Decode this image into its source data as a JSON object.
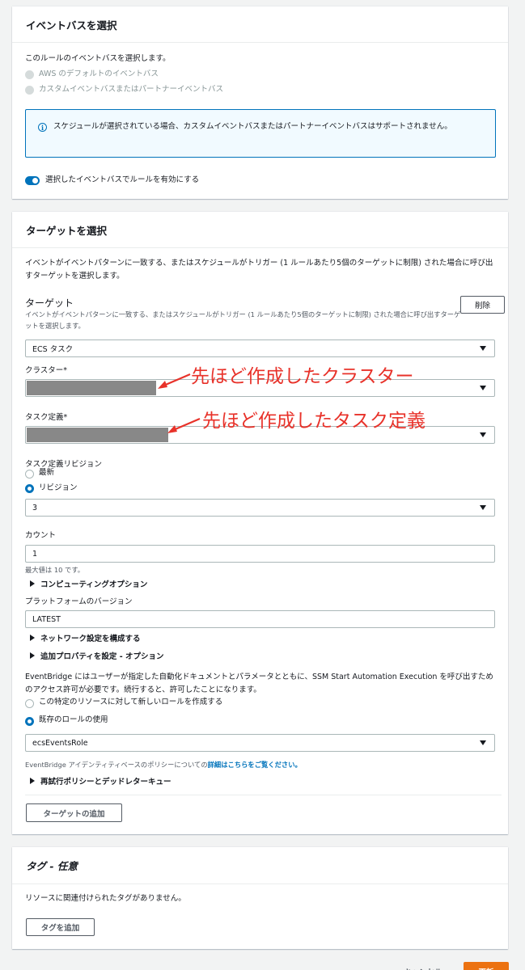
{
  "event_bus_panel": {
    "title": "イベントバスを選択",
    "description": "このルールのイベントバスを選択します。",
    "options": [
      "AWS のデフォルトのイベントバス",
      "カスタムイベントバスまたはパートナーイベントバス"
    ],
    "info_text": "スケジュールが選択されている場合、カスタムイベントバスまたはパートナーイベントバスはサポートされません。",
    "toggle_label": "選択したイベントバスでルールを有効にする",
    "toggle_on": true
  },
  "target_panel": {
    "title": "ターゲットを選択",
    "description": "イベントがイベントパターンに一致する、またはスケジュールがトリガー (1 ルールあたり5個のターゲットに制限) された場合に呼び出すターゲットを選択します。",
    "target_heading": "ターゲット",
    "target_sub": "イベントがイベントパターンに一致する、またはスケジュールがトリガー (1 ルールあたり5個のターゲットに制限) された場合に呼び出すターゲットを選択します。",
    "delete_label": "削除",
    "target_type": "ECS タスク",
    "cluster_label": "クラスター*",
    "task_def_label": "タスク定義*",
    "revision_label": "タスク定義リビジョン",
    "revision_options": [
      "最新",
      "リビジョン"
    ],
    "revision_value": "3",
    "count_label": "カウント",
    "count_value": "1",
    "count_hint": "最大値は 10 です。",
    "compute_options": "コンピューティングオプション",
    "platform_label": "プラットフォームのバージョン",
    "platform_value": "LATEST",
    "network_config": "ネットワーク設定を構成する",
    "additional_props": "追加プロパティを設定 - オプション",
    "permission_text": "EventBridge にはユーザーが指定した自動化ドキュメントとパラメータとともに、SSM Start Automation Execution を呼び出すためのアクセス許可が必要です。続行すると、許可したことになります。",
    "role_options": [
      "この特定のリソースに対して新しいロールを作成する",
      "既存のロールの使用"
    ],
    "role_value": "ecsEventsRole",
    "policy_text": "EventBridge アイデンティティベースのポリシーについての",
    "policy_link": "詳細はこちらをご覧ください。",
    "retry_policy": "再試行ポリシーとデッドレターキュー",
    "add_target_label": "ターゲットの追加"
  },
  "tags_panel": {
    "title": "タグ - 任意",
    "empty_text": "リソースに関連付けられたタグがありません。",
    "add_tag_label": "タグを追加"
  },
  "footer": {
    "cancel_label": "キャンセル",
    "update_label": "更新"
  },
  "annotations": {
    "cluster_note": "先ほど作成したクラスター",
    "task_note": "先ほど作成したタスク定義"
  }
}
